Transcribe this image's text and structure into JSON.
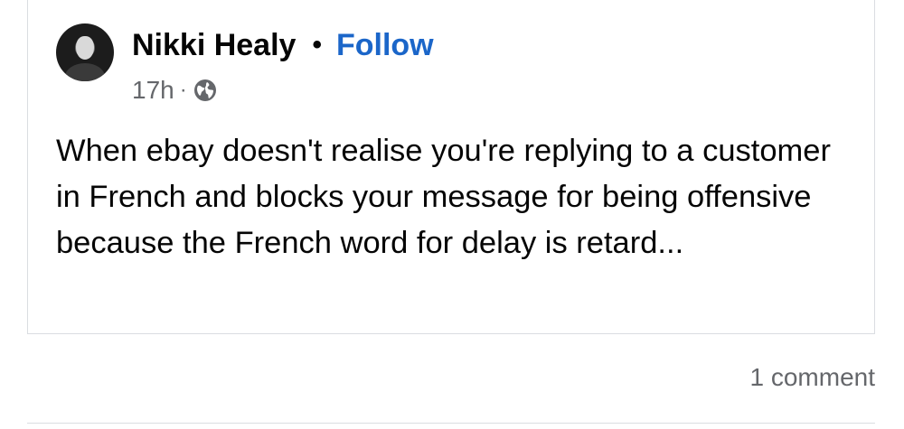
{
  "post": {
    "author": "Nikki Healy",
    "separator": "•",
    "follow_label": "Follow",
    "timestamp": "17h",
    "meta_separator": "·",
    "privacy_icon": "globe-icon",
    "text": "When ebay doesn't realise you're replying to a customer in French and blocks your message for being offensive because the French word for delay is retard..."
  },
  "footer": {
    "comment_count": "1 comment"
  },
  "colors": {
    "follow_link": "#1b66c9",
    "secondary_text": "#65676b",
    "border": "#dadde1"
  }
}
